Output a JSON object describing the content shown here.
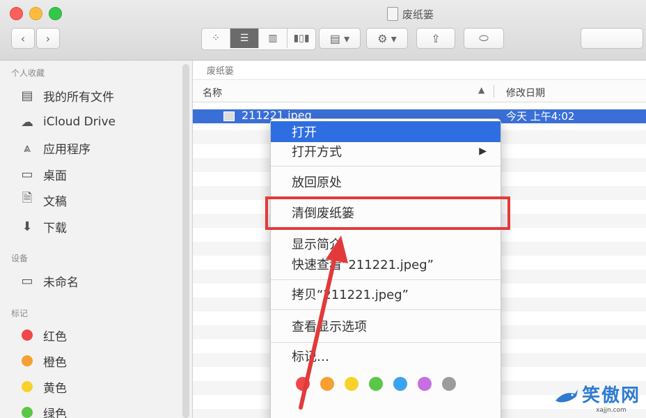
{
  "window": {
    "title": "废纸篓"
  },
  "toolbar": {
    "back_icon": "chevron-left-icon",
    "forward_icon": "chevron-right-icon",
    "view_modes": [
      "icon-view",
      "list-view",
      "column-view",
      "cover-flow-view"
    ],
    "active_view": "list-view"
  },
  "sidebar": {
    "favorites_header": "个人收藏",
    "favorites": [
      {
        "label": "我的所有文件",
        "icon": "all-files-icon"
      },
      {
        "label": "iCloud Drive",
        "icon": "cloud-icon"
      },
      {
        "label": "应用程序",
        "icon": "applications-icon"
      },
      {
        "label": "桌面",
        "icon": "desktop-icon"
      },
      {
        "label": "文稿",
        "icon": "document-icon"
      },
      {
        "label": "下载",
        "icon": "download-icon"
      }
    ],
    "devices_header": "设备",
    "devices": [
      {
        "label": "未命名",
        "icon": "disk-icon"
      }
    ],
    "tags_header": "标记",
    "tags": [
      {
        "label": "红色",
        "color": "#f0474a"
      },
      {
        "label": "橙色",
        "color": "#f5a031"
      },
      {
        "label": "黄色",
        "color": "#f7d22c"
      },
      {
        "label": "绿色",
        "color": "#5ac747"
      }
    ]
  },
  "main": {
    "path": "废纸篓",
    "columns": {
      "name": "名称",
      "date": "修改日期"
    },
    "file": {
      "name": "211221.jpeg",
      "date": "今天 上午4:02"
    }
  },
  "context_menu": {
    "open": "打开",
    "open_with": "打开方式",
    "put_back": "放回原处",
    "empty_trash": "清倒废纸篓",
    "get_info": "显示简介",
    "quick_look": "快速查看“211221.jpeg”",
    "copy": "拷贝“211221.jpeg”",
    "view_options": "查看显示选项",
    "tags": "标记…",
    "tag_colors": [
      "#f0474a",
      "#f5a031",
      "#f7d22c",
      "#5ac747",
      "#3aa3f0",
      "#c76ee0",
      "#9c9c9c"
    ]
  },
  "watermark": {
    "main": "笑傲网",
    "sub": "xajjn.com"
  }
}
